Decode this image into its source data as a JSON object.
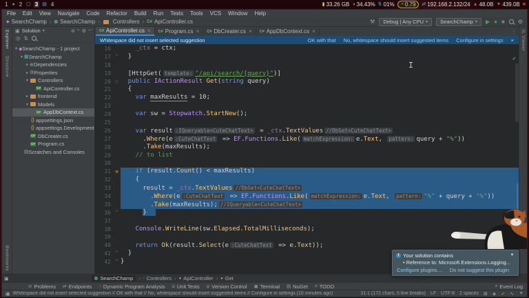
{
  "system_bar": {
    "workspaces": [
      {
        "label": "1"
      },
      {
        "icon": "leaf-icon"
      },
      {
        "label": "2"
      },
      {
        "icon": "monitor-icon"
      },
      {
        "label": "3",
        "active": true
      },
      {
        "icon": "file-icon"
      },
      {
        "label": "4"
      }
    ],
    "stats": [
      {
        "icon": "memory-icon",
        "text": "33.26 GB"
      },
      {
        "icon": "cpu-icon",
        "text": "34.43%"
      },
      {
        "icon": "gpu-icon",
        "text": "01%"
      },
      {
        "icon": "load-icon",
        "text": "0.79",
        "pill": true
      },
      {
        "icon": "network-icon",
        "text": "192.168.2.132/24"
      },
      {
        "icon": "upload-icon",
        "text": "48.0B"
      },
      {
        "icon": "download-icon",
        "text": "439.0B"
      },
      {
        "icon": "power-icon",
        "text": ""
      }
    ]
  },
  "menu_bar": [
    "File",
    "Edit",
    "View",
    "Navigate",
    "Code",
    "Refactor",
    "Build",
    "Run",
    "Tests",
    "Tools",
    "VCS",
    "Window",
    "Help"
  ],
  "toolbar": {
    "breadcrumb": [
      {
        "icon": "solution-icon",
        "label": "SearchChamp"
      },
      {
        "icon": "project-icon",
        "label": "SearchChamp"
      },
      {
        "icon": "folder-icon",
        "label": "Controllers"
      },
      {
        "icon": "csharp-file-icon",
        "label": "ApiController.cs"
      }
    ],
    "run_config": "Debug | Any CPU",
    "solution": "SearchChamp"
  },
  "stripes": {
    "left_top": [
      "Explorer",
      "Structure"
    ],
    "left_bottom": [
      "Bookmarks"
    ],
    "right": [
      "IL Viewer"
    ]
  },
  "explorer": {
    "header": "Solution",
    "tree": [
      {
        "d": 0,
        "icon": "solution-icon",
        "label": "SearchChamp - 1 project",
        "exp": true
      },
      {
        "d": 1,
        "icon": "project-icon",
        "label": "SearchChamp",
        "exp": true
      },
      {
        "d": 2,
        "icon": "dependencies-icon",
        "label": "Dependencies",
        "exp": false
      },
      {
        "d": 2,
        "icon": "properties-icon",
        "label": "Properties",
        "exp": false
      },
      {
        "d": 2,
        "icon": "folder-icon",
        "label": "Controllers",
        "exp": true
      },
      {
        "d": 3,
        "icon": "csharp-file-icon",
        "label": "ApiController.cs"
      },
      {
        "d": 2,
        "icon": "folder-icon",
        "label": "frontend",
        "exp": false
      },
      {
        "d": 2,
        "icon": "folder-icon",
        "label": "Models",
        "exp": true
      },
      {
        "d": 3,
        "icon": "csharp-file-icon",
        "label": "AppDbContext.cs",
        "selected": true
      },
      {
        "d": 2,
        "icon": "json-file-icon",
        "label": "appsettings.json"
      },
      {
        "d": 2,
        "icon": "json-file-icon",
        "label": "appsettings.Development.json"
      },
      {
        "d": 2,
        "icon": "csharp-file-icon",
        "label": "DbCreater.cs"
      },
      {
        "d": 2,
        "icon": "csharp-file-icon",
        "label": "Program.cs"
      },
      {
        "d": 1,
        "icon": "scratches-icon",
        "label": "Scratches and Consoles"
      }
    ]
  },
  "tabs": [
    {
      "label": "ApiController.cs",
      "active": true
    },
    {
      "label": "Program.cs",
      "active": false
    },
    {
      "label": "DbCreater.cs",
      "active": false
    },
    {
      "label": "AppDbContext.cs",
      "active": false
    }
  ],
  "banner": {
    "message": "Whitespace did not insert selected suggestion",
    "actions": [
      "OK with that",
      "No, whitespace should insert suggested items",
      "Configure in settings"
    ]
  },
  "code": {
    "lines": [
      {
        "n": 16,
        "i": 2,
        "s": [
          [
            "f",
            "_ctx"
          ],
          [
            "p",
            " = ctx;"
          ]
        ]
      },
      {
        "n": 17,
        "i": 1,
        "g": "fold",
        "s": [
          [
            "p",
            "}"
          ]
        ]
      },
      {
        "n": 18,
        "i": 0,
        "s": []
      },
      {
        "n": 19,
        "i": 1,
        "s": [
          [
            "p",
            "[HttpGet("
          ],
          [
            "h",
            "template:"
          ],
          [
            "su",
            "\"/api/search/{query}\""
          ],
          [
            "p",
            ")]"
          ]
        ]
      },
      {
        "n": 20,
        "i": 1,
        "g": "circle",
        "s": [
          [
            "k",
            "public"
          ],
          [
            "p",
            " "
          ],
          [
            "t",
            "IActionResult"
          ],
          [
            "p",
            " "
          ],
          [
            "m",
            "Get"
          ],
          [
            "p",
            "("
          ],
          [
            "k",
            "string"
          ],
          [
            "p",
            " query)"
          ]
        ]
      },
      {
        "n": 21,
        "i": 1,
        "s": [
          [
            "p",
            "{"
          ]
        ]
      },
      {
        "n": 22,
        "i": 2,
        "s": [
          [
            "k",
            "var"
          ],
          [
            "p",
            " "
          ],
          [
            "u",
            "maxResults"
          ],
          [
            "p",
            " = "
          ],
          [
            "n",
            "10"
          ],
          [
            "p",
            ";"
          ]
        ]
      },
      {
        "n": 23,
        "i": 0,
        "s": []
      },
      {
        "n": 24,
        "i": 2,
        "s": [
          [
            "k",
            "var"
          ],
          [
            "p",
            " sw = "
          ],
          [
            "t",
            "Stopwatch"
          ],
          [
            "p",
            "."
          ],
          [
            "m",
            "StartNew"
          ],
          [
            "p",
            "();"
          ]
        ]
      },
      {
        "n": 25,
        "i": 0,
        "s": []
      },
      {
        "n": 26,
        "i": 2,
        "s": [
          [
            "k",
            "var"
          ],
          [
            "p",
            " result"
          ],
          [
            "h",
            ":IQueryable<CuteChatText>"
          ],
          [
            "p",
            " = "
          ],
          [
            "f",
            "_ctx"
          ],
          [
            "p",
            "."
          ],
          [
            "m",
            "TextValues"
          ],
          [
            "h",
            "//DbSet<CuteChatText>"
          ]
        ]
      },
      {
        "n": 27,
        "i": 3,
        "s": [
          [
            "p",
            "."
          ],
          [
            "m",
            "Where"
          ],
          [
            "p",
            "(e"
          ],
          [
            "h",
            ":CuteChatText"
          ],
          [
            "p",
            " => "
          ],
          [
            "t",
            "EF"
          ],
          [
            "p",
            "."
          ],
          [
            "t",
            "Functions"
          ],
          [
            "p",
            "."
          ],
          [
            "m",
            "Like"
          ],
          [
            "p",
            "("
          ],
          [
            "h",
            "matchExpression:"
          ],
          [
            "p",
            "e."
          ],
          [
            "m",
            "Text"
          ],
          [
            "p",
            ", "
          ],
          [
            "h",
            "pattern:"
          ],
          [
            "p",
            "query + "
          ],
          [
            "s",
            "\"%\""
          ],
          [
            "p",
            "))"
          ]
        ]
      },
      {
        "n": 28,
        "i": 3,
        "s": [
          [
            "p",
            "."
          ],
          [
            "m",
            "Take"
          ],
          [
            "p",
            "(maxResults);"
          ]
        ]
      },
      {
        "n": 29,
        "i": 2,
        "s": [
          [
            "c",
            "// to list"
          ]
        ]
      },
      {
        "n": 30,
        "i": 0,
        "s": []
      },
      {
        "n": 31,
        "i": 2,
        "g": "hammer",
        "sel": "full",
        "s": [
          [
            "k",
            "if"
          ],
          [
            "p",
            " (result."
          ],
          [
            "m",
            "Count"
          ],
          [
            "p",
            "() < maxResults)"
          ]
        ]
      },
      {
        "n": 32,
        "i": 2,
        "sel": "full",
        "s": [
          [
            "p",
            "{"
          ]
        ]
      },
      {
        "n": 33,
        "i": 3,
        "sel": "full",
        "s": [
          [
            "p",
            "result = "
          ],
          [
            "f",
            "_ctx"
          ],
          [
            "p",
            "."
          ],
          [
            "m",
            "TextValues"
          ],
          [
            "h",
            "//DbSet<CuteChatText>"
          ]
        ]
      },
      {
        "n": 34,
        "i": 4,
        "sel": "full",
        "s": [
          [
            "p",
            "."
          ],
          [
            "m",
            "Where"
          ],
          [
            "p",
            "(e"
          ],
          [
            "h",
            ":CuteChatText"
          ],
          [
            "p",
            " => "
          ],
          [
            "t",
            "EF"
          ],
          [
            "p",
            "."
          ],
          [
            "t",
            "Functions"
          ],
          [
            "p",
            "."
          ],
          [
            "m",
            "Like"
          ],
          [
            "p",
            "("
          ],
          [
            "h",
            "matchExpression:"
          ],
          [
            "p",
            "e."
          ],
          [
            "m",
            "Text"
          ],
          [
            "p",
            ", "
          ],
          [
            "h",
            "pattern:"
          ],
          [
            "s",
            "\"%\""
          ],
          [
            "p",
            " + query + "
          ],
          [
            "s",
            "\"%\""
          ],
          [
            "p",
            "))"
          ]
        ]
      },
      {
        "n": 35,
        "i": 4,
        "sel": "full",
        "s": [
          [
            "p",
            "."
          ],
          [
            "m",
            "Take"
          ],
          [
            "p",
            "(maxResults);"
          ],
          [
            "h",
            "//IQueryable<CuteChatText>"
          ]
        ]
      },
      {
        "n": 36,
        "i": 3,
        "g": "fold",
        "sel": "part",
        "s": [
          [
            "p",
            "}"
          ]
        ]
      },
      {
        "n": 37,
        "i": 0,
        "s": []
      },
      {
        "n": 38,
        "i": 2,
        "s": [
          [
            "t",
            "Console"
          ],
          [
            "p",
            "."
          ],
          [
            "m",
            "WriteLine"
          ],
          [
            "p",
            "(sw."
          ],
          [
            "m",
            "Elapsed"
          ],
          [
            "p",
            "."
          ],
          [
            "m",
            "TotalMilliseconds"
          ],
          [
            "p",
            ");"
          ]
        ]
      },
      {
        "n": 39,
        "i": 0,
        "s": []
      },
      {
        "n": 40,
        "i": 2,
        "s": [
          [
            "k",
            "return"
          ],
          [
            "p",
            " "
          ],
          [
            "m",
            "Ok"
          ],
          [
            "p",
            "(result."
          ],
          [
            "m",
            "Select"
          ],
          [
            "p",
            "(e"
          ],
          [
            "h",
            ":CuteChatText"
          ],
          [
            "p",
            " => e."
          ],
          [
            "m",
            "Text"
          ],
          [
            "p",
            "));"
          ]
        ]
      },
      {
        "n": 41,
        "i": 1,
        "g": "fold",
        "s": [
          [
            "p",
            "}"
          ]
        ]
      },
      {
        "n": 42,
        "i": 0,
        "g": "fold",
        "s": [
          [
            "p",
            "}"
          ]
        ]
      }
    ]
  },
  "breadcrumbs_bottom": [
    {
      "icon": "project-icon",
      "label": "SearchChamp",
      "chip": true
    },
    {
      "icon": "namespace-icon",
      "label": "Controllers"
    },
    {
      "icon": "class-icon",
      "label": "ApiController"
    },
    {
      "icon": "method-icon",
      "label": "Get"
    }
  ],
  "bottom_tools": {
    "items": [
      {
        "icon": "problems-icon",
        "label": "Problems"
      },
      {
        "icon": "endpoints-icon",
        "label": "Endpoints"
      },
      {
        "icon": "dpa-icon",
        "label": "Dynamic Program Analysis"
      },
      {
        "icon": "unit-tests-icon",
        "label": "Unit Tests"
      },
      {
        "icon": "version-control-icon",
        "label": "Version Control"
      },
      {
        "icon": "terminal-icon",
        "label": "Terminal"
      },
      {
        "icon": "nuget-icon",
        "label": "NuGet"
      },
      {
        "icon": "todo-icon",
        "label": "TODO"
      }
    ],
    "event_log": "Event Log"
  },
  "status_bar": {
    "message": "Whitespace did not insert selected suggestion // OK with that // No, whitespace should insert suggested items // Configure in settings (10 minutes ago)",
    "segments": [
      "31:1 (172 chars, 5 line breaks)",
      "LF",
      "UTF-8",
      "2 spaces"
    ],
    "icons": [
      "readonly-icon",
      "theme-icon",
      "inspections-ok-icon",
      "highlight-level-icon",
      "expand-icon"
    ]
  },
  "popup": {
    "title": "Your solution contains",
    "detail": "• Reference to: Microsoft.Extensions.Logging...",
    "actions": [
      "Configure plugins....",
      "Do not suggest this plugin"
    ]
  },
  "colors": {
    "selection": "#2A5A86",
    "banner": "#1E4B73",
    "tab_underline": "#4A88C7",
    "popup_bg": "#45565F",
    "run_green": "#499C54",
    "string_green": "#69A85C",
    "keyword_blue": "#6C95EB",
    "method_yellow": "#FFC66D"
  }
}
